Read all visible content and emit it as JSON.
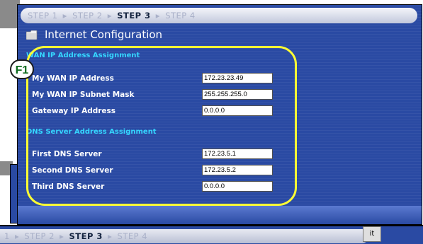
{
  "wizard": {
    "steps": [
      "STEP 1",
      "STEP 2",
      "STEP 3",
      "STEP 4"
    ],
    "separator": "▸",
    "current_step": "STEP 3",
    "title": "Internet Configuration"
  },
  "wan_section": {
    "title": "WAN IP Address Assignment",
    "fields": [
      {
        "label": "My WAN IP Address",
        "value": "172.23.23.49"
      },
      {
        "label": "My WAN IP Subnet Mask",
        "value": "255.255.255.0"
      },
      {
        "label": "Gateway IP Address",
        "value": "0.0.0.0"
      }
    ]
  },
  "dns_section": {
    "title": "DNS Server Address Assignment",
    "fields": [
      {
        "label": "First DNS Server",
        "value": "172.23.5.1"
      },
      {
        "label": "Second DNS Server",
        "value": "172.23.5.2"
      },
      {
        "label": "Third DNS Server",
        "value": "0.0.0.0"
      }
    ]
  },
  "callout": {
    "label": "F1"
  },
  "background_window": {
    "steps": [
      "1",
      "STEP 2",
      "STEP 3",
      "STEP 4"
    ],
    "exit_label": "it"
  },
  "icons": {
    "folder": "folder-icon"
  },
  "colors": {
    "panel_blue": "#2a4aa3",
    "section_cyan": "#35d7ff",
    "highlight_yellow": "#ffff33",
    "callout_green": "#0d6b1d"
  }
}
